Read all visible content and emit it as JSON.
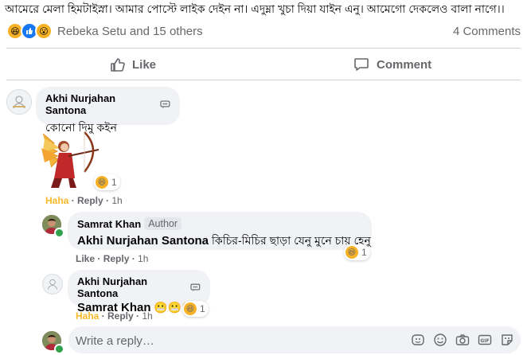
{
  "post": {
    "text": "আমেরে মেলা হিমটাইস্না। আমার পোস্টে লাইক দেইন না। এদুম্না খুচা দিয়া যাইন এনু। আমেগো দেকলেও বালা নাগে।।"
  },
  "reactions_bar": {
    "names": "Rebeka Setu and 15 others",
    "comments_count": "4 Comments",
    "icons": [
      "haha-emoji",
      "like-thumb",
      "wow-emoji"
    ]
  },
  "actions": {
    "like_label": "Like",
    "comment_label": "Comment"
  },
  "comments": [
    {
      "author": "Akhi Nurjahan Santona",
      "text": "কোনো দিমু কইন",
      "sticker": "archer-woman-sticker",
      "reaction_count": "1",
      "meta": {
        "reaction": "Haha",
        "reply": "Reply",
        "time": "1h"
      }
    }
  ],
  "replies": [
    {
      "author": "Samrat Khan",
      "badge": "Author",
      "mention": "Akhi Nurjahan Santona",
      "text": "কিচির-মিচির ছাড়া যেনু মুনে চায় হেনু",
      "reaction_count": "1",
      "meta": {
        "reaction": "Like",
        "reply": "Reply",
        "time": "1h"
      }
    },
    {
      "author": "Akhi Nurjahan Santona",
      "mention": "Samrat Khan",
      "text": "😬😬😬",
      "reaction_count": "1",
      "meta": {
        "reaction": "Haha",
        "reply": "Reply",
        "time": "1h"
      }
    }
  ],
  "reply_box": {
    "placeholder": "Write a reply…"
  },
  "colors": {
    "haha": "#f7b928",
    "like": "#1877f2",
    "online": "#31a24c",
    "bubble": "#f0f2f5",
    "muted": "#65676b"
  }
}
